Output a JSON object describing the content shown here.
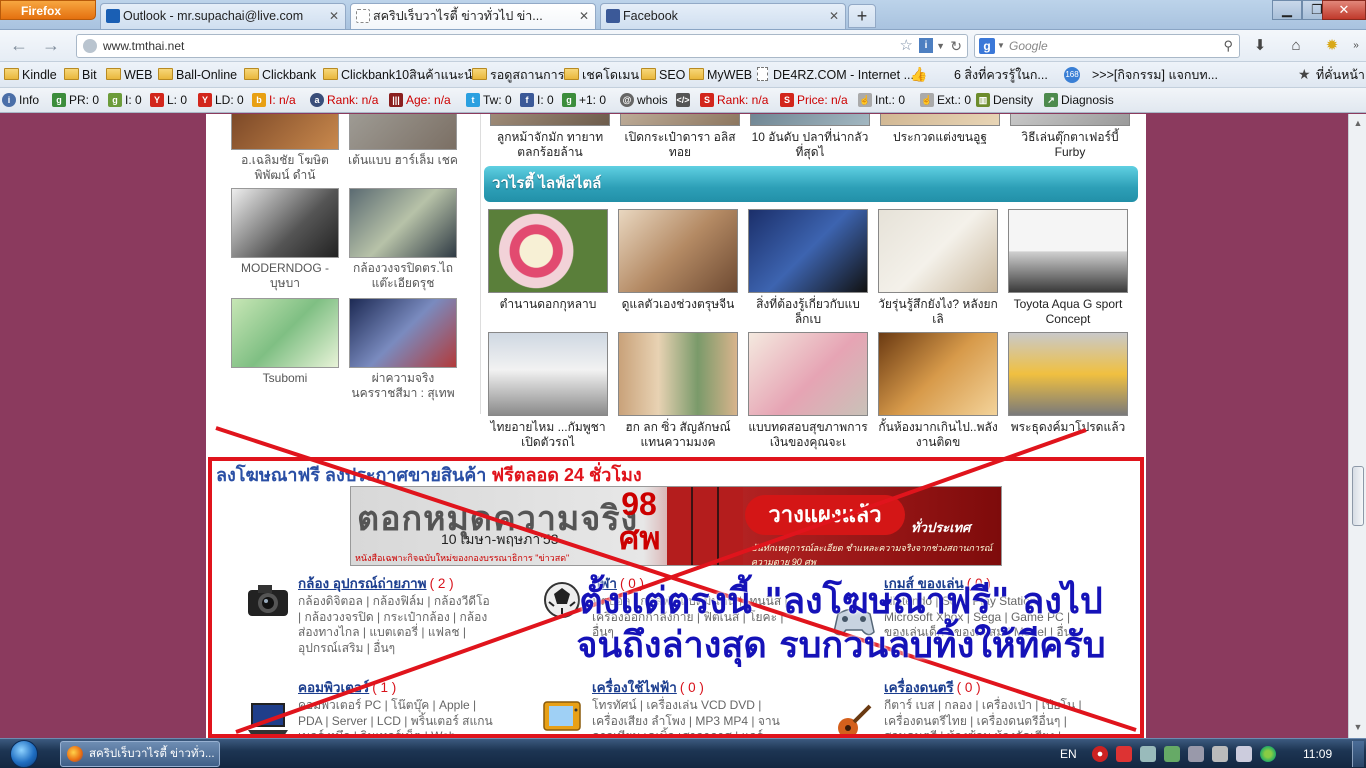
{
  "browser": {
    "menu_button": "Firefox",
    "tabs": [
      {
        "label": "Outlook - mr.supachai@live.com",
        "color": "#1a5fb4"
      },
      {
        "label": "สคริปเร็บวาไรตี้ ข่าวทั่วไป ข่า...",
        "color": "#ffffff"
      },
      {
        "label": "Facebook",
        "color": "#3b5998"
      }
    ],
    "new_tab": "+",
    "url": "www.tmthai.net",
    "search_placeholder": "Google",
    "bookmarks": [
      "Kindle",
      "Bit",
      "WEB",
      "Ball-Online",
      "Clickbank",
      "Clickbank10สินค้าแนะนำ",
      "รอดูสถานการ",
      "เชคโดเมน",
      "SEO",
      "MyWEB",
      "DE4RZ.COM - Internet ...",
      "6 สิ่งที่ควรรู้ในก...",
      ">>>[กิจกรรม] แจกบท...",
      "ที่คั่นหน้า"
    ],
    "seo_toolbar": {
      "info": "Info",
      "pr": "PR: 0",
      "i1": "I: 0",
      "l": "L: 0",
      "ld": "LD: 0",
      "i_na": "I: n/a",
      "rank": "Rank: n/a",
      "age": "Age: n/a",
      "tw": "Tw: 0",
      "i2": "I: 0",
      "plus": "+1: 0",
      "whois": "whois",
      "rank2": "Rank: n/a",
      "price": "Price: n/a",
      "int": "Int.: 0",
      "ext": "Ext.: 0",
      "density": "Density",
      "diagnosis": "Diagnosis"
    }
  },
  "page": {
    "left_videos": [
      {
        "caption": "อ.เฉลิมชัย โฆษิตพิพัฒน์ ดำน้"
      },
      {
        "caption": "เต้นแบบ ฮาร์เล็ม เชค"
      },
      {
        "caption": "MODERNDOG - บุษบา"
      },
      {
        "caption": "กล้องวงจรปิดตร.ไถแต๊ะเอียดรุช"
      },
      {
        "caption": "Tsubomi"
      },
      {
        "caption": "ผ่าความจริง นครราชสีมา : สุเทพ"
      }
    ],
    "top_row": [
      {
        "caption": "ลูกหม้าจักมัก ทายาทตลกร้อยล้าน"
      },
      {
        "caption": "เปิดกระเป๋าดารา อลิสทอย"
      },
      {
        "caption": "10 อันดับ ปลาที่น่ากลัวที่สุดไ"
      },
      {
        "caption": "ประกวดแต่งขนอูฐ"
      },
      {
        "caption": "วิธีเล่นตุ๊กตาเฟอร์บี้ Furby"
      }
    ],
    "section_title": "วาไรตี้ ไลฟ์สไตล์",
    "grid_row1": [
      {
        "caption": "ตำนานดอกกุหลาบ"
      },
      {
        "caption": "ดูแลตัวเองช่วงตรุษจีน"
      },
      {
        "caption": "สิ่งที่ต้องรู้เกี่ยวกับแบล็กเบ"
      },
      {
        "caption": "วัยรุ่นรู้สึกยังไง? หลังยกเลิ"
      },
      {
        "caption": "Toyota Aqua G sport Concept"
      }
    ],
    "grid_row2": [
      {
        "caption": "ไทยอายไหม ...กัมพูชาเปิดตัวรถไ"
      },
      {
        "caption": "ฮก ลก ซิ่ว สัญลักษณ์แทนความมงค"
      },
      {
        "caption": "แบบทดสอบสุขภาพการเงินของคุณจะเ"
      },
      {
        "caption": "กั้นห้องมากเกินไป..พลังงานติดข"
      },
      {
        "caption": "พระธุดงค์มาโปรดแล้ว"
      }
    ],
    "ad": {
      "title_blue": "ลงโฆษณาฟรี ลงประกาศขายสินค้า",
      "title_red": "ฟรีตลอด 24 ชั่วโมง",
      "banner_main": "ตอกหมุดความจริง",
      "banner_date": "10 เมษา-พฤษภา'53",
      "banner_num": "98 ศพ",
      "banner_pill": "วางแผงแล้ว",
      "banner_nation": "ทั่วประเทศ",
      "banner_small": "หนังสือเฉพาะกิจฉบับใหม่ของกองบรรณาธิการ \"ข่าวสด\"",
      "banner_small2": "บันทึกเหตุการณ์ละเอียด ชำแหละความจริงจากช่วงสถานการณ์ ความตาย 90 ศพ"
    },
    "categories": [
      {
        "title": "กล้อง อุปกรณ์ถ่ายภาพ",
        "count": "( 2 )",
        "links": "กล้องดิจิตอล | กล้องฟิล์ม | กล้องวีดีโอ | กล้องวงจรปิด | กระเป๋ากล้อง | กล้องส่องทางไกล | แบตเตอรี่ | แฟลช | อุปกรณ์เสริม | อื่นๆ"
      },
      {
        "title": "กีฬา",
        "count": "( 0 )",
        "links": "ฟุตบอล | กอล์ฟ | แบดมินตัน | เทนนิส | เครื่องออกกำลังกาย | ฟิตเนส | โยคะ | อื่นๆ"
      },
      {
        "title": "เกมส์ ของเล่น",
        "count": "( 0 )",
        "links": "Nintendo | Sony Play Station | Microsoft Xbox | Sega | Game PC | ของเล่นเด็ก | ของสะสม | Model | อื่นๆ"
      },
      {
        "title": "คอมพิวเตอร์",
        "count": "( 1 )",
        "links": "คอมพิวเตอร์ PC | โน๊ตบุ๊ค | Apple | PDA | Server | LCD | พริ้นเตอร์ สแกนเนอร์ หมึก | อินเทอร์เน็ต | Web Hosting Web"
      },
      {
        "title": "เครื่องใช้ไฟฟ้า",
        "count": "( 0 )",
        "links": "โทรทัศน์ | เครื่องเล่น VCD DVD | เครื่องเสียง ลำโพง | MP3 MP4 | จานดาวเทียม เคเบิ้ล เสาอากาศ | แอร์ พัดลม เครื่องซักผ้า |"
      },
      {
        "title": "เครื่องดนตรี",
        "count": "( 0 )",
        "links": "กีตาร์ เบส | กลอง | เครื่องเป่า | เปียโน | เครื่องดนตรีไทย | เครื่องดนตรีอื่นๆ | สอนดนตรี | ห้องซ้อม ห้องอัดเสียง | อื่นๆ"
      }
    ],
    "overlay_note": "ตั้งแต่ตรงนี้ \"ลงโฆษณาฟรี\" ลงไปจนถึงล่างสุด รบกวนลบทิ้งให้ทีครับ",
    "overlay_color": "#e0141c"
  },
  "taskbar": {
    "task_label": "สคริปเร็บวาไรตี้ ข่าวทั่ว...",
    "lang": "EN",
    "clock": "11:09"
  }
}
